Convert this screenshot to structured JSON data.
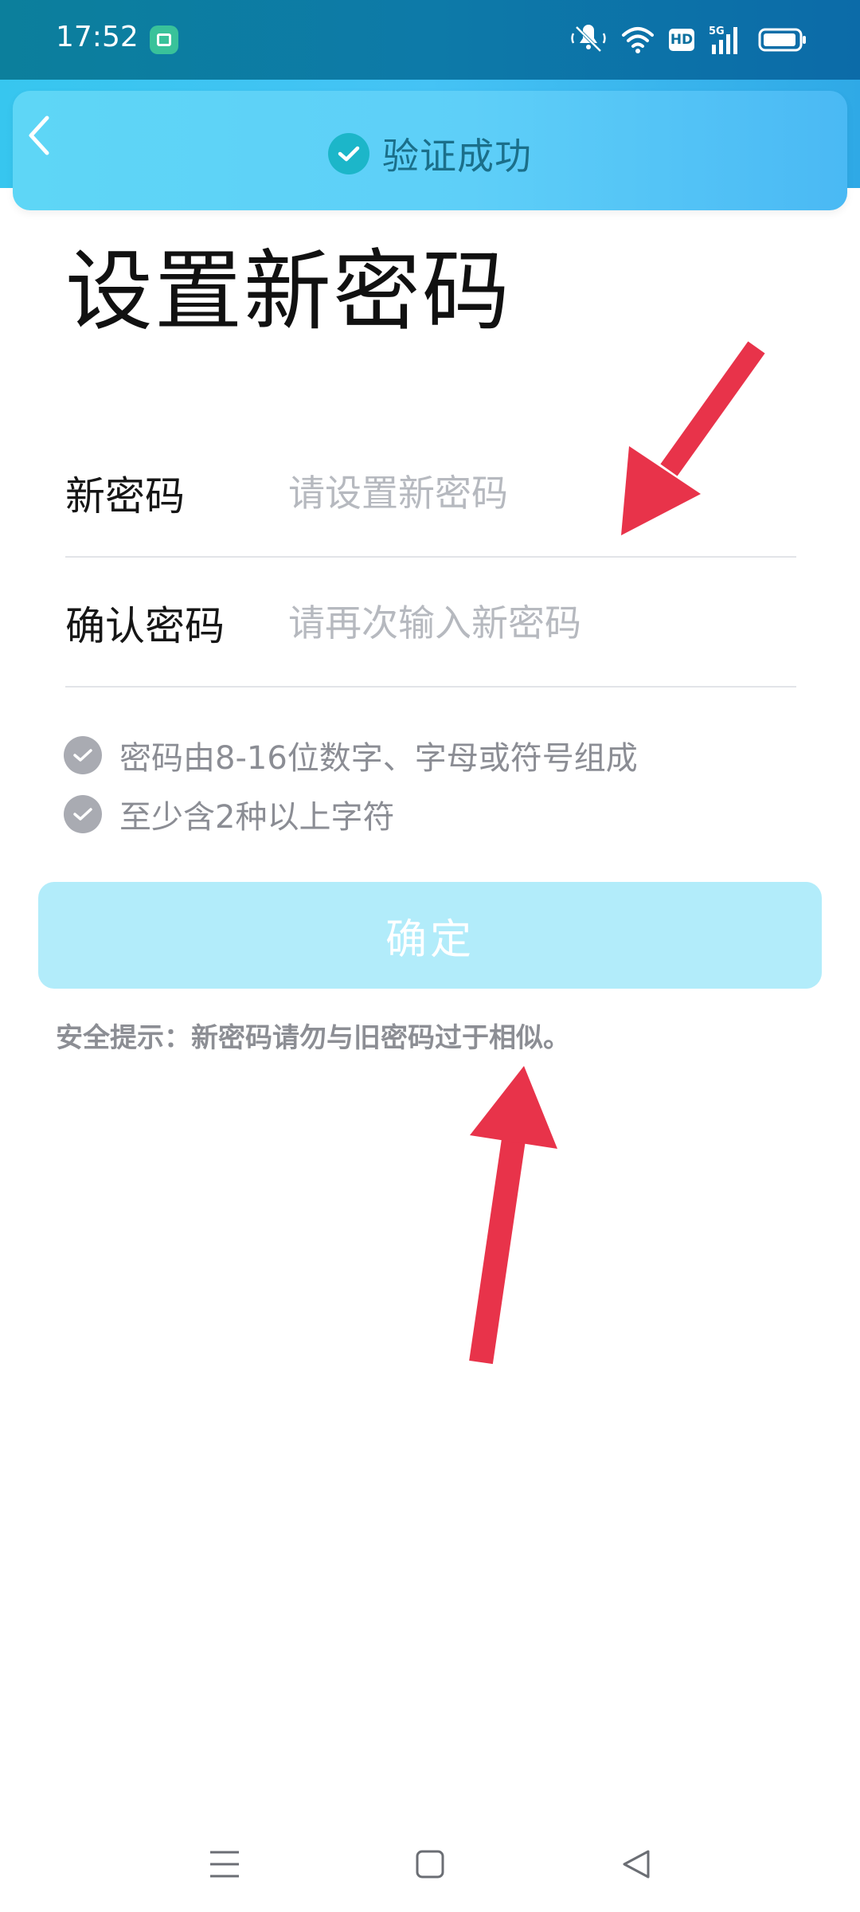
{
  "status_bar": {
    "time": "17:52",
    "hd_label": "HD",
    "network_label": "5G",
    "icons": [
      "app-notification-icon",
      "silent-mode-icon",
      "wifi-icon",
      "hd-icon",
      "signal-5g-icon",
      "battery-icon"
    ]
  },
  "header": {
    "back_icon": "chevron-left-icon",
    "verify_text": "验证成功",
    "verify_icon": "check-circle-icon",
    "colors": {
      "band": "#37c6ef",
      "card": "#5ed6f6",
      "check": "#1cb6c9"
    }
  },
  "form": {
    "title": "设置新密码",
    "new_password": {
      "label": "新密码",
      "placeholder": "请设置新密码",
      "value": ""
    },
    "confirm_password": {
      "label": "确认密码",
      "placeholder": "请再次输入新密码",
      "value": ""
    },
    "rules": [
      {
        "text": "密码由8-16位数字、字母或符号组成",
        "icon": "check-circle-icon"
      },
      {
        "text": "至少含2种以上字符",
        "icon": "check-circle-icon"
      }
    ],
    "confirm_label": "确定",
    "confirm_color": "#b2ecfa",
    "security_tip": "安全提示：新密码请勿与旧密码过于相似。"
  },
  "annotations": {
    "arrow_color": "#e8334a"
  },
  "nav_bar": {
    "icons": [
      "menu-icon",
      "home-icon",
      "back-icon"
    ]
  }
}
